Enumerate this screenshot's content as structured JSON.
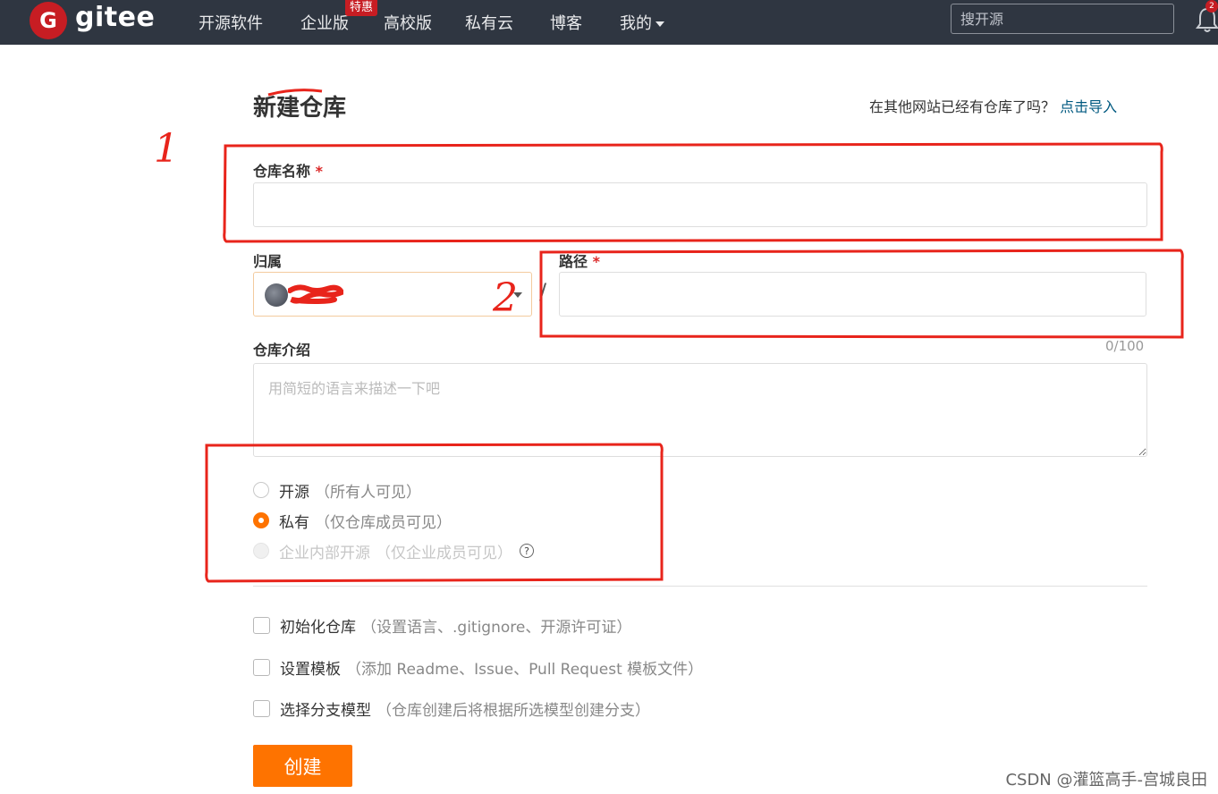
{
  "nav": {
    "logo_letter": "G",
    "logo_text": "gitee",
    "items": [
      "开源软件",
      "企业版",
      "高校版",
      "私有云",
      "博客",
      "我的"
    ],
    "promo_badge": "特惠",
    "search_placeholder": "搜开源",
    "notification_count": "2",
    "bell_icon": "bell-icon"
  },
  "page": {
    "title": "新建仓库",
    "import_hint": "在其他网站已经有仓库了吗？",
    "import_link": "点击导入"
  },
  "form": {
    "repo_name_label": "仓库名称",
    "required_mark": "*",
    "owner_label": "归属",
    "owner_name": "",
    "path_separator": "/",
    "path_label": "路径",
    "desc_label": "仓库介绍",
    "desc_counter": "0/100",
    "desc_placeholder": "用简短的语言来描述一下吧",
    "visibility": [
      {
        "label": "开源",
        "hint": "（所有人可见）",
        "state": "unchecked"
      },
      {
        "label": "私有",
        "hint": "（仅仓库成员可见）",
        "state": "checked"
      },
      {
        "label": "企业内部开源",
        "hint": "（仅企业成员可见）",
        "state": "disabled"
      }
    ],
    "help_glyph": "?",
    "options": [
      {
        "label": "初始化仓库",
        "hint": "（设置语言、.gitignore、开源许可证）"
      },
      {
        "label": "设置模板",
        "hint": "（添加 Readme、Issue、Pull Request 模板文件）"
      },
      {
        "label": "选择分支模型",
        "hint": "（仓库创建后将根据所选模型创建分支）"
      }
    ],
    "submit_label": "创建"
  },
  "annotations": {
    "marker_1": "1",
    "marker_2": "2",
    "color": "#e8241b"
  },
  "watermark": "CSDN @灌篮高手-宫城良田",
  "colors": {
    "nav_bg": "#2f3641",
    "brand_red": "#c71d23",
    "accent_orange": "#fe7300",
    "link": "#005980"
  }
}
